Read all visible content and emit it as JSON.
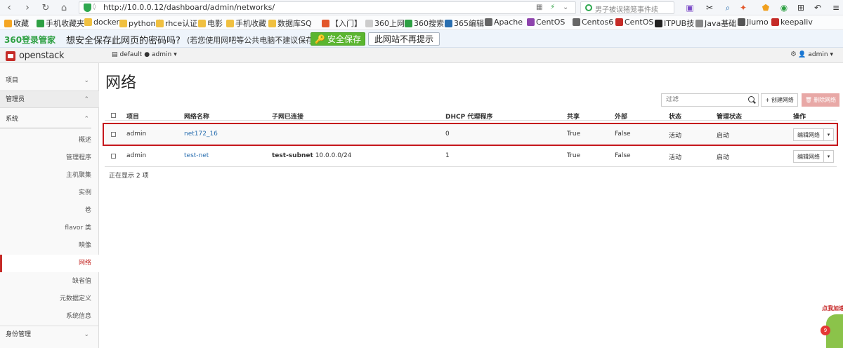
{
  "browser": {
    "security_tag": "◊",
    "url": "http://10.0.0.12/dashboard/admin/networks/",
    "search_text": "男子被误猪笼事件续"
  },
  "bookmarks": [
    {
      "label": "收藏",
      "color": "#f5a623"
    },
    {
      "label": "手机收藏夹",
      "color": "#2ea043"
    },
    {
      "label": "docker",
      "color": "#f0c040"
    },
    {
      "label": "python学",
      "color": "#f0c040"
    },
    {
      "label": "rhce认证",
      "color": "#f0c040"
    },
    {
      "label": "电影",
      "color": "#f0c040"
    },
    {
      "label": "手机收藏",
      "color": "#f0c040"
    },
    {
      "label": "数据库SQ",
      "color": "#f0c040"
    },
    {
      "label": "【入门】",
      "color": "#e2572b"
    },
    {
      "label": "360上网",
      "color": "#cccccc"
    },
    {
      "label": "360搜索",
      "color": "#2ea043"
    },
    {
      "label": "365编辑",
      "color": "#2a6fb0"
    },
    {
      "label": "Apache",
      "color": "#666666"
    },
    {
      "label": "CentOS",
      "color": "#8e44ad"
    },
    {
      "label": "Centos6",
      "color": "#666666"
    },
    {
      "label": "CentOS",
      "color": "#c52b27"
    },
    {
      "label": "ITPUB技",
      "color": "#222222"
    },
    {
      "label": "Java基础",
      "color": "#888888"
    },
    {
      "label": "Jiumo E",
      "color": "#555555"
    },
    {
      "label": "keepaliv",
      "color": "#c52b27"
    }
  ],
  "password_bar": {
    "brand": "360登录管家",
    "message": "想安全保存此网页的密码吗?",
    "sub_message": "(若您使用网吧等公共电脑不建议保存)",
    "save_label": "安全保存",
    "never_label": "此网站不再提示"
  },
  "header": {
    "logo": "openstack",
    "project_label": "default",
    "project_user": "admin",
    "user_label": "admin"
  },
  "sidebar": {
    "sections": [
      {
        "label": "项目",
        "chevron": "⌄"
      },
      {
        "label": "管理员",
        "chevron": "⌃"
      },
      {
        "label": "系统",
        "chevron": "⌃"
      },
      {
        "label": "身份管理",
        "chevron": "⌄"
      }
    ],
    "items": [
      {
        "label": "概述"
      },
      {
        "label": "管理程序"
      },
      {
        "label": "主机聚集"
      },
      {
        "label": "实例"
      },
      {
        "label": "卷"
      },
      {
        "label": "flavor 类"
      },
      {
        "label": "映像"
      },
      {
        "label": "网络",
        "active": true
      },
      {
        "label": "缺省值"
      },
      {
        "label": "元数据定义"
      },
      {
        "label": "系统信息"
      }
    ]
  },
  "main": {
    "title": "网络",
    "filter_placeholder": "过滤",
    "create_label": "创建网络",
    "delete_label": "删除网络",
    "columns": [
      "项目",
      "网络名称",
      "子网已连接",
      "DHCP 代理程序",
      "共享",
      "外部",
      "状态",
      "管理状态",
      "操作"
    ],
    "rows": [
      {
        "project": "admin",
        "name": "net172_16",
        "subnet_name": "",
        "subnet_cidr": "",
        "dhcp": "0",
        "shared": "True",
        "external": "False",
        "status": "活动",
        "admin_state": "启动",
        "action": "编辑网络"
      },
      {
        "project": "admin",
        "name": "test-net",
        "subnet_name": "test-subnet",
        "subnet_cidr": "10.0.0.0/24",
        "dhcp": "1",
        "shared": "True",
        "external": "False",
        "status": "活动",
        "admin_state": "启动",
        "action": "编辑网络"
      }
    ],
    "count_text": "正在显示 2 项"
  },
  "widget": {
    "label": "点我加速",
    "badge": "9"
  }
}
